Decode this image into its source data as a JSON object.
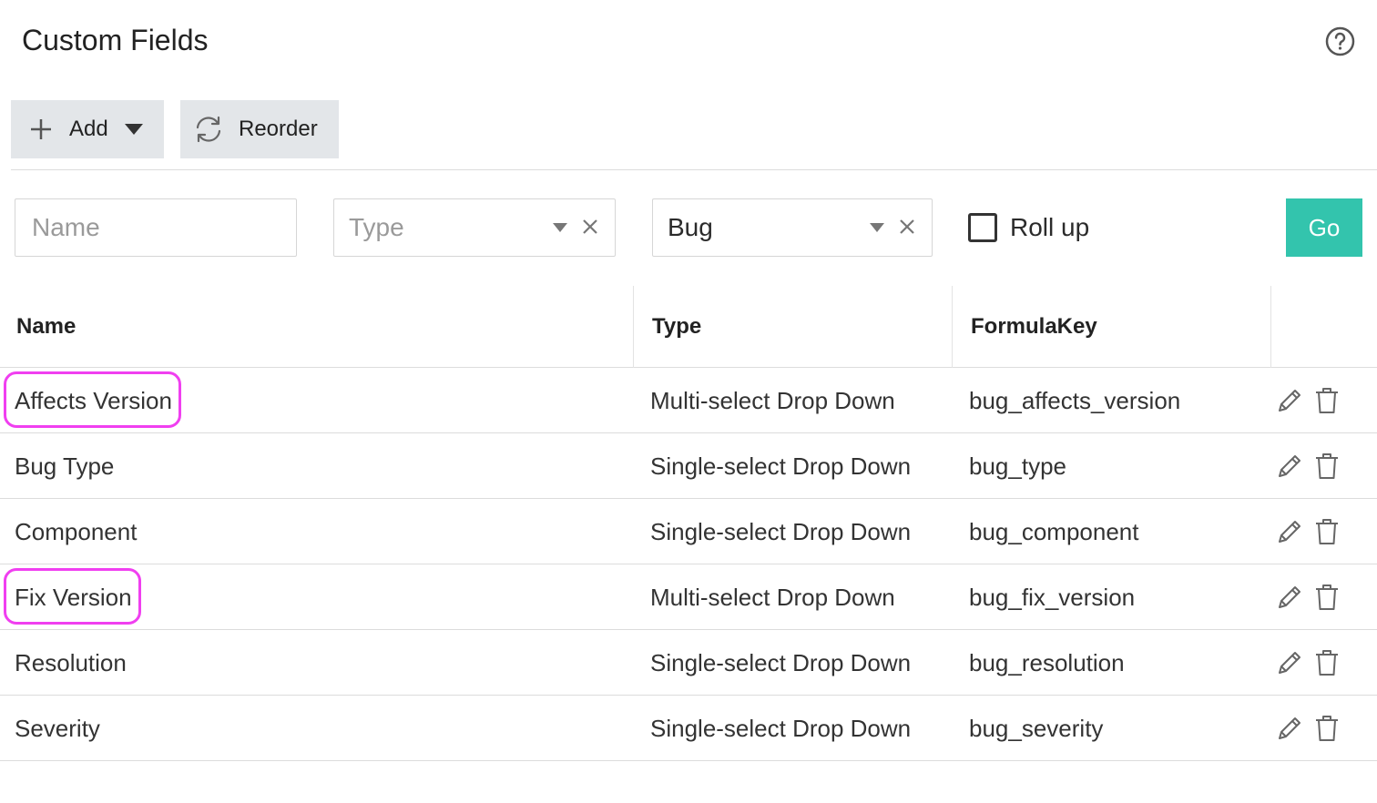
{
  "header": {
    "title": "Custom Fields",
    "help_icon": "question-circle-icon"
  },
  "toolbar": {
    "add_label": "Add",
    "reorder_label": "Reorder"
  },
  "filters": {
    "name_placeholder": "Name",
    "type_placeholder": "Type",
    "item_value": "Bug",
    "rollup_label": "Roll up",
    "rollup_checked": false,
    "go_label": "Go"
  },
  "table": {
    "columns": [
      "Name",
      "Type",
      "FormulaKey"
    ],
    "rows": [
      {
        "name": "Affects Version",
        "type": "Multi-select Drop Down",
        "formula_key": "bug_affects_version",
        "highlighted": true
      },
      {
        "name": "Bug Type",
        "type": "Single-select Drop Down",
        "formula_key": "bug_type",
        "highlighted": false
      },
      {
        "name": "Component",
        "type": "Single-select Drop Down",
        "formula_key": "bug_component",
        "highlighted": false
      },
      {
        "name": "Fix Version",
        "type": "Multi-select Drop Down",
        "formula_key": "bug_fix_version",
        "highlighted": true
      },
      {
        "name": "Resolution",
        "type": "Single-select Drop Down",
        "formula_key": "bug_resolution",
        "highlighted": false
      },
      {
        "name": "Severity",
        "type": "Single-select Drop Down",
        "formula_key": "bug_severity",
        "highlighted": false
      }
    ]
  },
  "colors": {
    "accent": "#33c4ad",
    "highlight": "#f03ff0",
    "button_bg": "#e3e6e9"
  }
}
